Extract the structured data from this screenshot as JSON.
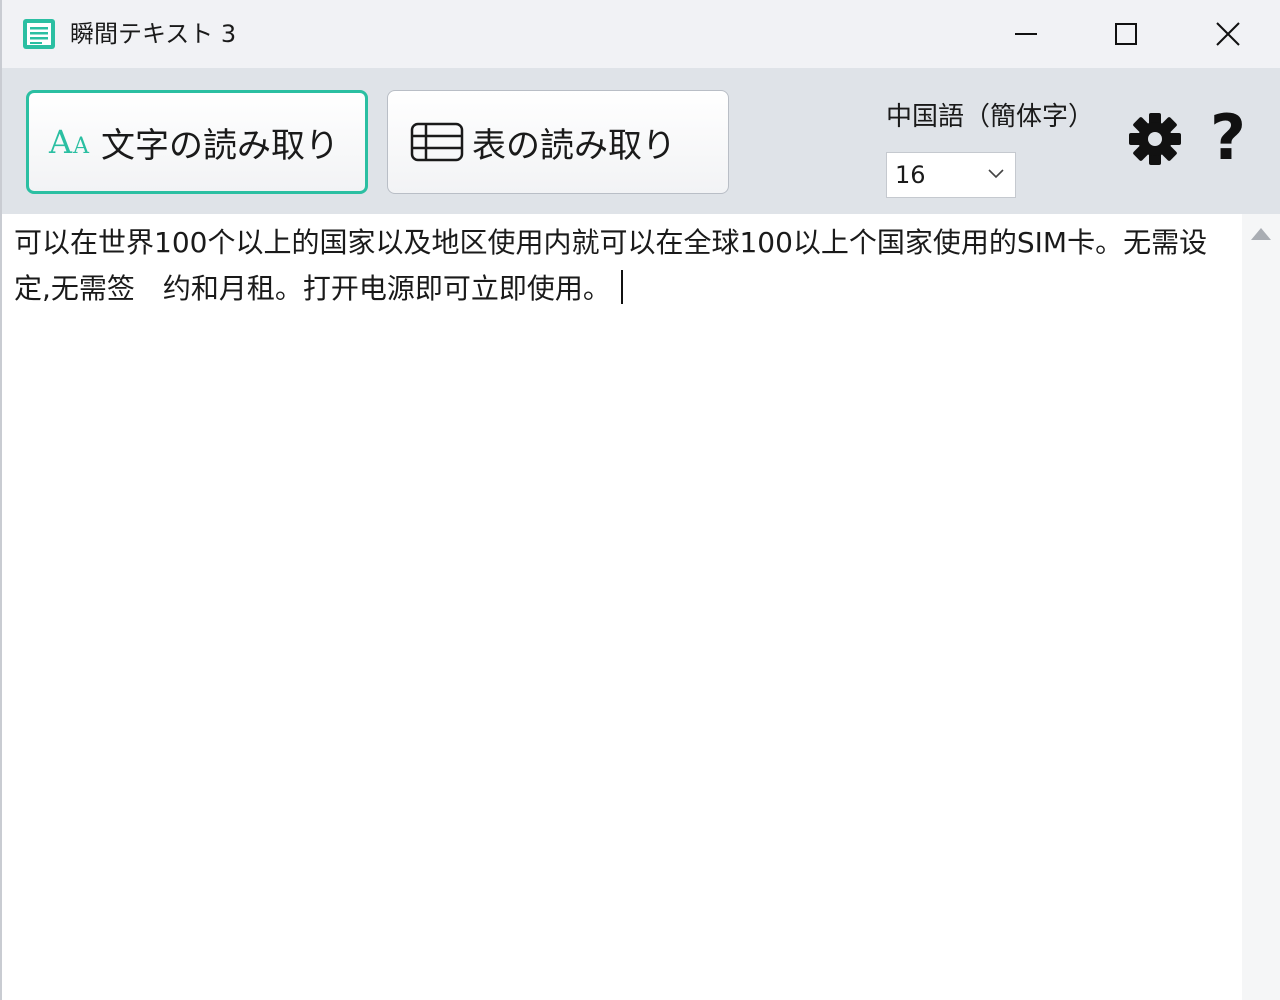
{
  "window": {
    "title": "瞬間テキスト 3"
  },
  "toolbar": {
    "text_mode_label": "文字の読み取り",
    "text_mode_icon_big": "A",
    "text_mode_icon_small": "A",
    "table_mode_label": "表の読み取り",
    "language_label": "中国語（簡体字）",
    "font_size_value": "16",
    "help_label": "?"
  },
  "editor": {
    "text": "可以在世界100个以上的国家以及地区使用内就可以在全球100以上个国家使用的SIM卡。无需设定,无需签　约和月租。打开电源即可立即使用。"
  },
  "icons": {
    "app": "app-icon",
    "minimize": "minimize-icon",
    "maximize": "maximize-icon",
    "close": "close-icon",
    "text_mode": "font-aa-icon",
    "table_mode": "table-icon",
    "dropdown": "chevron-down-icon",
    "settings": "gear-icon",
    "help": "question-mark-icon",
    "scroll_up": "arrow-up-icon"
  },
  "colors": {
    "accent": "#2bbfa2",
    "toolbar_bg": "#dfe3e8",
    "titlebar_bg": "#f1f2f5"
  }
}
